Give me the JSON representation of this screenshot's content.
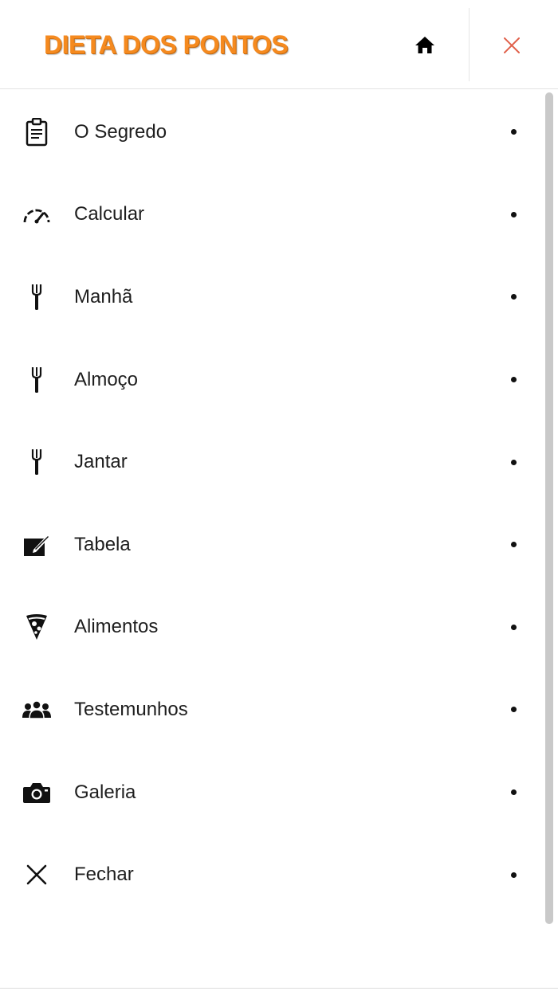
{
  "header": {
    "logo_text": "DIETA DOS PONTOS",
    "home_icon": "home-icon",
    "close_icon": "close-icon"
  },
  "menu": {
    "items": [
      {
        "label": "O Segredo",
        "icon": "clipboard-icon"
      },
      {
        "label": "Calcular",
        "icon": "speedometer-icon"
      },
      {
        "label": "Manhã",
        "icon": "fork-icon"
      },
      {
        "label": "Almoço",
        "icon": "fork-icon"
      },
      {
        "label": "Jantar",
        "icon": "fork-icon"
      },
      {
        "label": "Tabela",
        "icon": "edit-icon"
      },
      {
        "label": "Alimentos",
        "icon": "pizza-icon"
      },
      {
        "label": "Testemunhos",
        "icon": "group-icon"
      },
      {
        "label": "Galeria",
        "icon": "camera-icon"
      },
      {
        "label": "Fechar",
        "icon": "close-icon"
      }
    ]
  },
  "colors": {
    "logo": "#f58a1f",
    "close": "#e0604a",
    "text": "#1e1e1e"
  }
}
